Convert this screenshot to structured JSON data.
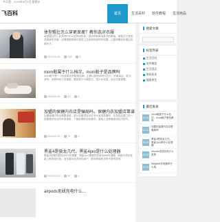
{
  "topbar": {
    "text": "今天是：2024年5月3日 星期五"
  },
  "header": {
    "logo": "飞百科",
    "nav": [
      "首页",
      "生活百科",
      "软件教程",
      "生活用品"
    ]
  },
  "posts": [
    {
      "title": "体型粗壮怎么穿更显瘦？教你选对衣服",
      "desc": "体型粗壮的人在穿衣时可以选择深色系、直线条和简洁款式的服装，避免过于宽松或紧身的衣服，合理搭配能够在视觉上达到修饰身材的效果，让整体看起来更加协调大方。",
      "date": "2024-05-03",
      "views": "133",
      "comments": "0"
    },
    {
      "title": "mom鞋属于什么档次，mom鞋子是品牌吗",
      "desc": "mom鞋子是一个比较常见的鞋类品牌，主要以舒适休闲为主打，价格亲民，款式多样，深受年轻人的喜爱，整体属于中端档次，性价比较高，适合日常穿着。",
      "date": "2024-05-03",
      "views": "81",
      "comments": "0"
    },
    {
      "title": "加盟的保健内衣店是骗局吗，保健内衣加盟店靠谱吗",
      "desc": "加盟保健内衣店需要谨慎，部分加盟项目存在夸大宣传的情况，在选择加盟之前一定要做好充分的市场调查，了解品牌的实际情况，避免上当受骗造成经济损失。",
      "date": "2024-05-03",
      "views": "72",
      "comments": "0"
    },
    {
      "title": "黑鲨4是骁龙几代，黑鲨4pro是什么处理器",
      "desc": "黑鲨4搭载的是骁龙870处理器，黑鲨4pro搭载的是骁龙888处理器，两款手机在性能上都表现出色，适合喜欢玩游戏的用户，散热和续航也有不错的表现。",
      "date": "2024-05-03",
      "views": "95",
      "comments": "0"
    },
    {
      "title": "airpods无线充电什么…",
      "desc": "",
      "date": "",
      "views": "",
      "comments": ""
    }
  ],
  "sidebar": {
    "search_title": "搜索文章",
    "tags_title": "标签列表",
    "tags": [
      "生活百科",
      "软件教程",
      "生活用品",
      "数码科技",
      "健康养生"
    ],
    "recent_title": "最近发表",
    "recent": [
      {
        "date": "11-03",
        "text": "mom鞋属于什么档次，mom鞋子是品牌吗"
      },
      {
        "date": "11-03",
        "text": "加盟的保健内衣店是骗局吗"
      },
      {
        "date": "11-03",
        "text": "黑鲨4是骁龙几代，黑鲨4pro是什么处理器"
      },
      {
        "date": "11-02",
        "text": "airpods无线充电什么意思"
      },
      {
        "date": "11-02",
        "text": "Magsafe充电器有什么用"
      }
    ]
  },
  "colors": {
    "accent": "#1f99c9"
  }
}
